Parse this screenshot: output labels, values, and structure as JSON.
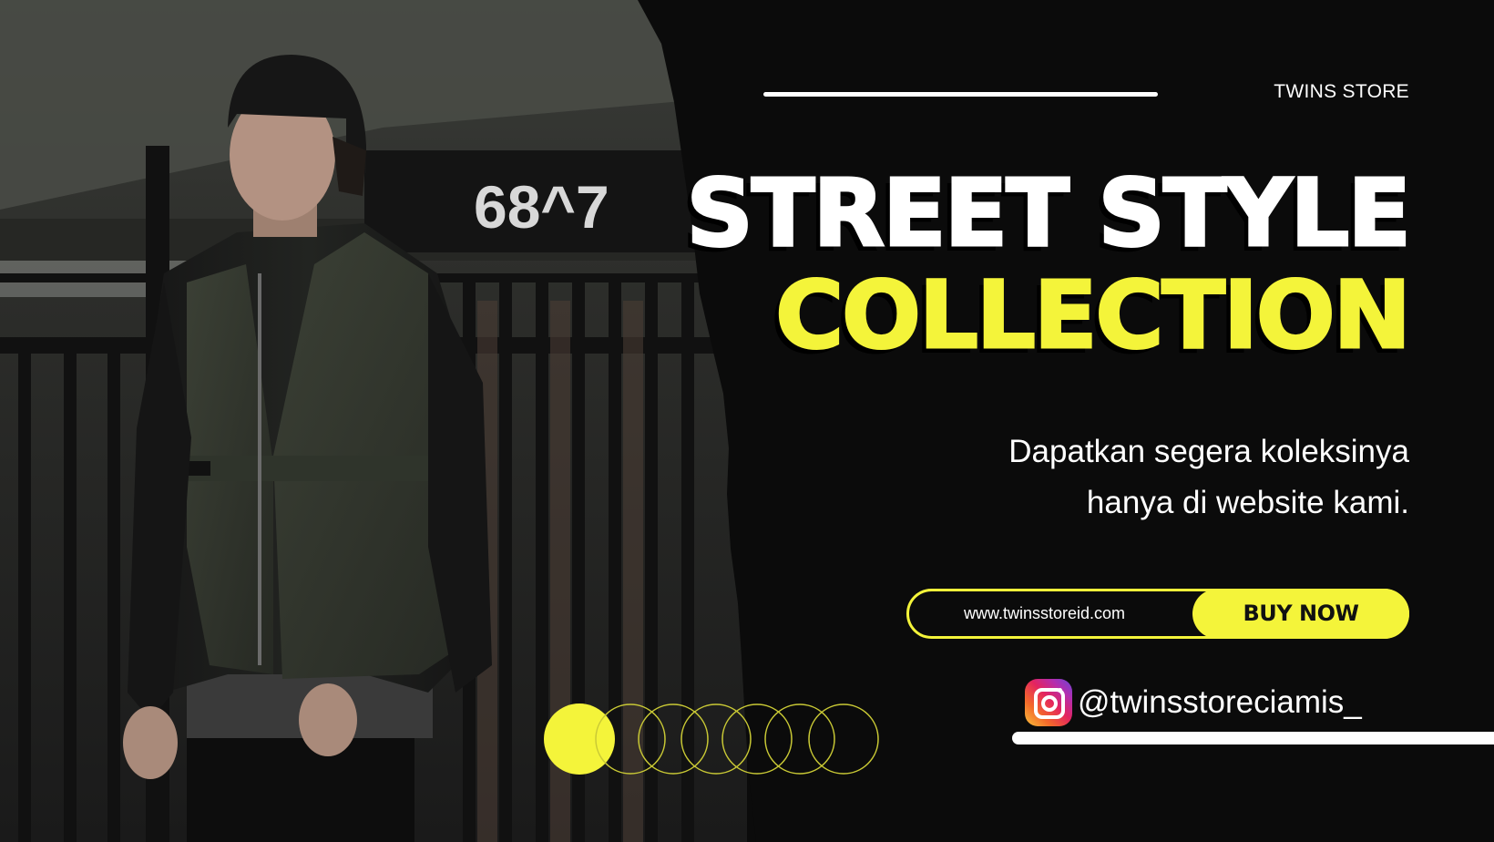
{
  "brand": "TWINS STORE",
  "headline": {
    "line1": "STREET STYLE",
    "line2": "COLLECTION"
  },
  "tagline": {
    "line1": "Dapatkan segera koleksinya",
    "line2": "hanya di website kami."
  },
  "cta": {
    "url": "www.twinsstoreid.com",
    "button": "BUY NOW"
  },
  "social": {
    "icon": "instagram-icon",
    "handle": "@twinsstoreciamis_"
  },
  "photo": {
    "sign_text": "68^7"
  },
  "colors": {
    "accent": "#f4f43a",
    "background": "#0b0b0b",
    "text": "#ffffff"
  }
}
